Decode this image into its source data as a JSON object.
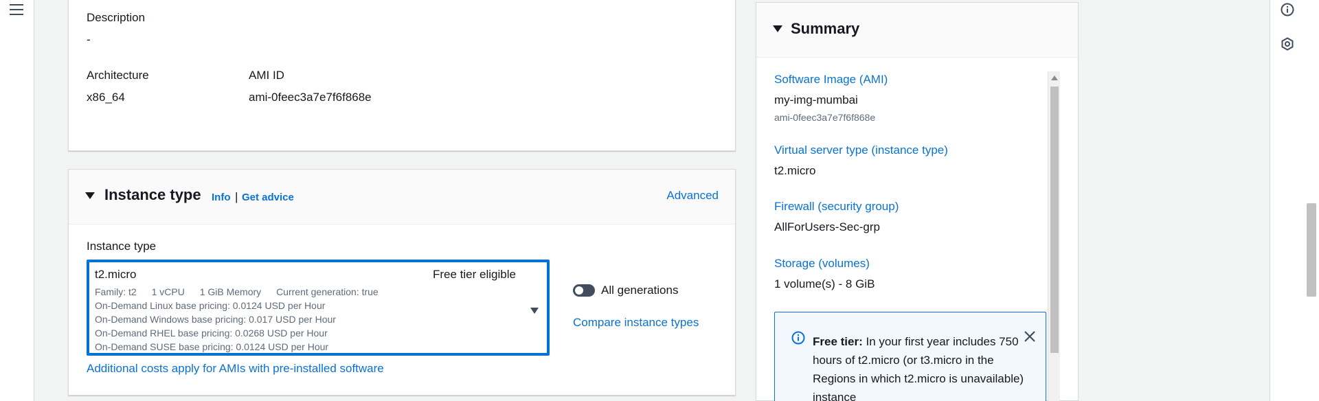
{
  "ami_section": {
    "description_label": "Description",
    "description_value": "-",
    "architecture_label": "Architecture",
    "architecture_value": "x86_64",
    "ami_id_label": "AMI ID",
    "ami_id_value": "ami-0feec3a7e7f6f868e"
  },
  "instance_type_section": {
    "title": "Instance type",
    "info_link": "Info",
    "separator": "|",
    "get_advice_link": "Get advice",
    "advanced_link": "Advanced",
    "field_label": "Instance type",
    "selected": {
      "name": "t2.micro",
      "badge": "Free tier eligible",
      "family": "Family: t2",
      "vcpu": "1 vCPU",
      "memory": "1 GiB Memory",
      "generation": "Current generation: true",
      "pricing": [
        "On-Demand Linux base pricing: 0.0124 USD per Hour",
        "On-Demand Windows base pricing: 0.017 USD per Hour",
        "On-Demand RHEL base pricing: 0.0268 USD per Hour",
        "On-Demand SUSE base pricing: 0.0124 USD per Hour"
      ]
    },
    "all_generations_label": "All generations",
    "all_generations_on": false,
    "compare_link": "Compare instance types",
    "additional_costs_link": "Additional costs apply for AMIs with pre-installed software"
  },
  "summary": {
    "title": "Summary",
    "software_image_label": "Software Image (AMI)",
    "software_image_name": "my-img-mumbai",
    "software_image_id": "ami-0feec3a7e7f6f868e",
    "server_type_label": "Virtual server type (instance type)",
    "server_type_value": "t2.micro",
    "firewall_label": "Firewall (security group)",
    "firewall_value": "AllForUsers-Sec-grp",
    "storage_label": "Storage (volumes)",
    "storage_value": "1 volume(s) - 8 GiB",
    "free_tier_bold": "Free tier:",
    "free_tier_text": " In your first year includes 750 hours of t2.micro (or t3.micro in the Regions in which t2.micro is unavailable) instance"
  },
  "colors": {
    "link": "#0972d3",
    "focus_border": "#0073d1",
    "toggle_off": "#414d5c"
  },
  "icons": [
    "menu-icon",
    "caret-down-icon",
    "info-circle-icon",
    "close-icon",
    "info-icon",
    "hexagon-icon"
  ]
}
